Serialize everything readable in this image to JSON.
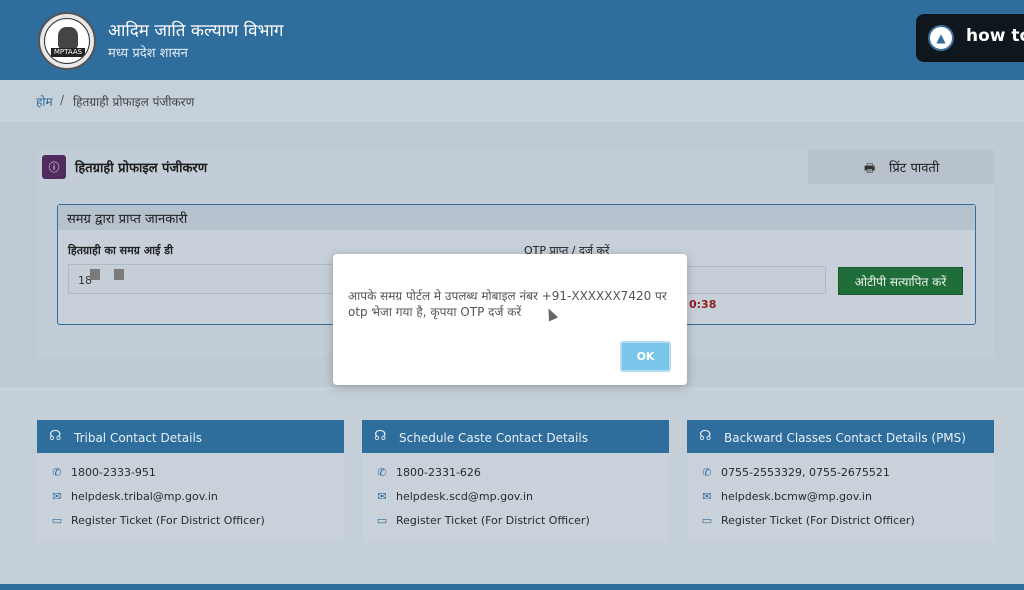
{
  "header": {
    "logo_text": "MPTAAS",
    "dept_title": "आदिम जाति कल्याण विभाग",
    "dept_subtitle": "मध्य प्रदेश शासन",
    "video_overlay": "how to"
  },
  "breadcrumb": {
    "home": "होम",
    "separator": "/",
    "current": "हितग्राही प्रोफाइल पंजीकरण"
  },
  "tabs": {
    "registration": "हितग्राही प्रोफाइल पंजीकरण",
    "print": "प्रिंट पावती",
    "info_icon": "info-icon",
    "print_icon": "printer-icon"
  },
  "samagra": {
    "title": "समग्र द्वारा प्राप्त जानकारी",
    "id_label": "हितग्राही का समग्र आई डी",
    "id_value": "18",
    "otp_label": "OTP प्राप्त / दर्ज करें",
    "timer": "0:38",
    "verify_button": "ओटीपी सत्यापित करें"
  },
  "contacts": [
    {
      "title": "Tribal Contact Details",
      "phone": "1800-2333-951",
      "email": "helpdesk.tribal@mp.gov.in",
      "ticket": "Register Ticket (For District Officer)"
    },
    {
      "title": "Schedule Caste Contact Details",
      "phone": "1800-2331-626",
      "email": "helpdesk.scd@mp.gov.in",
      "ticket": "Register Ticket (For District Officer)"
    },
    {
      "title": "Backward Classes Contact Details (PMS)",
      "phone": "0755-2553329, 0755-2675521",
      "email": "helpdesk.bcmw@mp.gov.in",
      "ticket": "Register Ticket (For District Officer)"
    }
  ],
  "modal": {
    "message": "आपके समग्र पोर्टल मे उपलब्ध मोबाइल नंबर +91-XXXXXX7420 पर otp भेजा गया है, कृपया OTP दर्ज करें",
    "ok_button": "OK"
  },
  "colors": {
    "header_blue": "#2f6d9c",
    "verify_green": "#1f6e3a",
    "ok_blue": "#7cc5ea",
    "timer_red": "#8c1d1d"
  }
}
